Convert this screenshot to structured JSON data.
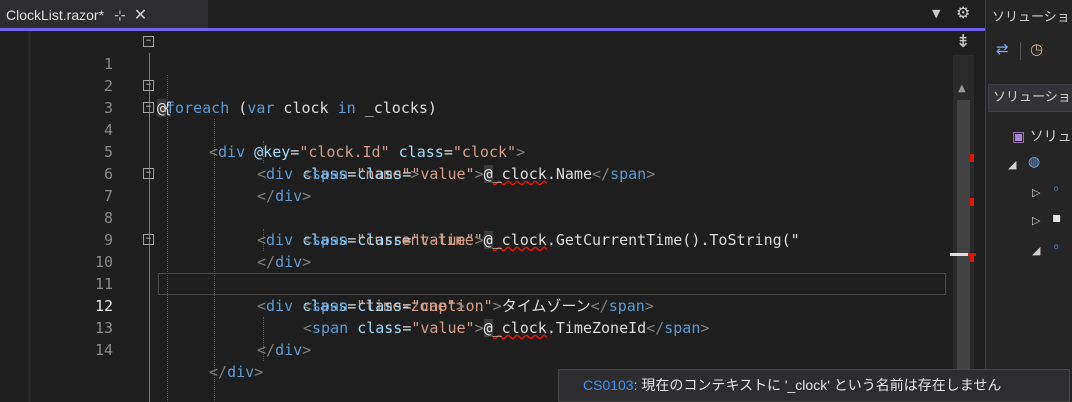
{
  "tab": {
    "title": "ClockList.razor*",
    "pin_glyph": "⊹",
    "close_glyph": "✕",
    "accent": "#7160e8"
  },
  "editor": {
    "lines": [
      {
        "num": "1"
      },
      {
        "num": "2"
      },
      {
        "num": "3"
      },
      {
        "num": "4"
      },
      {
        "num": "5"
      },
      {
        "num": "6"
      },
      {
        "num": "7"
      },
      {
        "num": "8"
      },
      {
        "num": "9"
      },
      {
        "num": "10"
      },
      {
        "num": "11"
      },
      {
        "num": "12"
      },
      {
        "num": "13"
      },
      {
        "num": "14"
      }
    ],
    "active_line": "12",
    "tokens": {
      "l1_at": "@",
      "l1_foreach": "foreach",
      "l1_open": " (",
      "l1_var": "var",
      "l1_rest": " clock ",
      "l1_in": "in",
      "l1_coll": " _clocks)",
      "l2": "{",
      "l3_attr1": "@key",
      "l3_val1": "\"clock.Id\"",
      "l3_attr2": "class",
      "l3_val2": "\"clock\"",
      "l4_val": "\"name\"",
      "l5_val": "\"value\"",
      "l5_at": "@",
      "l5_var": "_clock",
      "l5_member": ".Name",
      "l7_val": "\"current-time\"",
      "l8_val": "\"value\"",
      "l8_at": "@",
      "l8_var": "_clock",
      "l8_member": ".GetCurrentTime().ToString(\"",
      "l10_val": "\"time-zone\"",
      "l11_val": "\"caption\"",
      "l11_text": "タイムゾーン",
      "l12_val": "\"value\"",
      "l12_at": "@",
      "l12_var": "_clock",
      "l12_member": ".TimeZoneId",
      "div": "div",
      "span": "span",
      "class": "class"
    }
  },
  "solution_explorer": {
    "title": "ソリューション",
    "search_text": "ソリューション",
    "item_root": "ソリュ",
    "arrow_expanded": "◢",
    "arrow_collapsed": "▷"
  },
  "tooltip": {
    "code": "CS0103",
    "message": ": 現在のコンテキストに '_clock' という名前は存在しません"
  }
}
